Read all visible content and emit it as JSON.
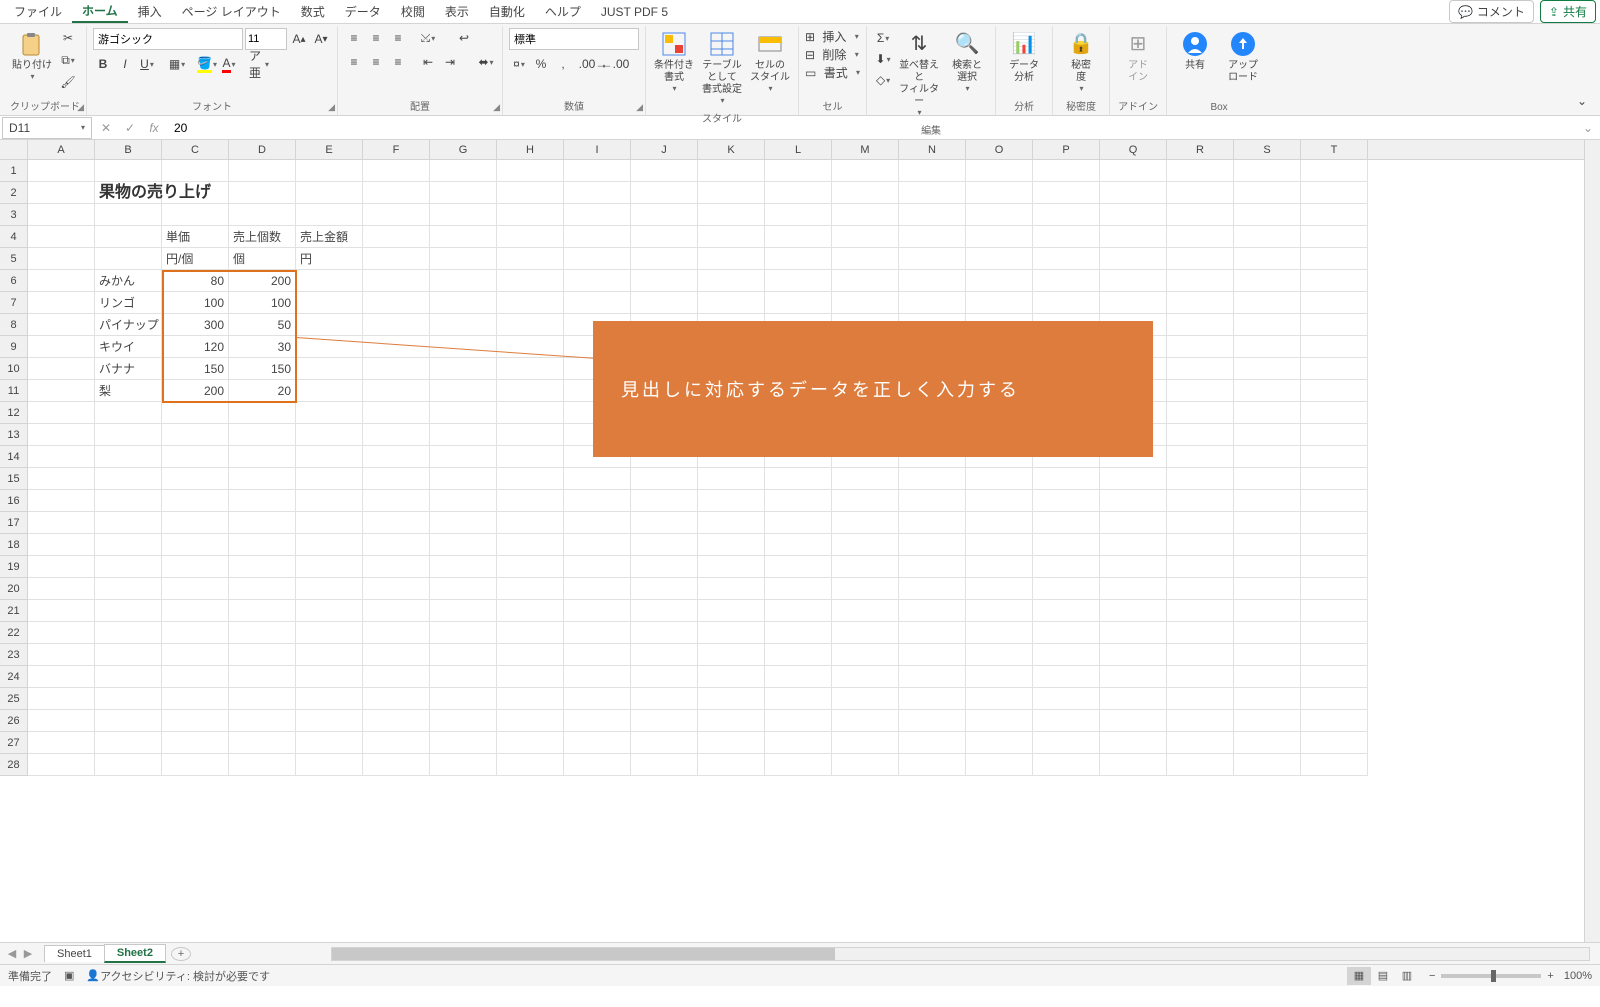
{
  "tabs": {
    "file": "ファイル",
    "home": "ホーム",
    "insert": "挿入",
    "page_layout": "ページ レイアウト",
    "formulas": "数式",
    "data": "データ",
    "review": "校閲",
    "view": "表示",
    "automate": "自動化",
    "help": "ヘルプ",
    "just_pdf": "JUST PDF 5"
  },
  "header_buttons": {
    "comment": "コメント",
    "share": "共有"
  },
  "ribbon": {
    "clipboard": {
      "paste": "貼り付け",
      "label": "クリップボード"
    },
    "font": {
      "name": "游ゴシック",
      "size": "11",
      "label": "フォント"
    },
    "alignment": {
      "label": "配置"
    },
    "number": {
      "format": "標準",
      "label": "数値"
    },
    "styles": {
      "cond": "条件付き\n書式",
      "table": "テーブルとして\n書式設定",
      "cell": "セルの\nスタイル",
      "label": "スタイル"
    },
    "cells": {
      "insert": "挿入",
      "delete": "削除",
      "format": "書式",
      "label": "セル"
    },
    "editing": {
      "sort": "並べ替えと\nフィルター",
      "find": "検索と\n選択",
      "label": "編集"
    },
    "analysis": {
      "data": "データ\n分析",
      "label": "分析"
    },
    "sensitivity": {
      "btn": "秘密\n度",
      "label": "秘密度"
    },
    "addins": {
      "btn": "アド\nイン",
      "label": "アドイン"
    },
    "box": {
      "share": "共有",
      "upload": "アップ\nロード",
      "label": "Box"
    }
  },
  "namebox": "D11",
  "formula_value": "20",
  "columns": [
    "A",
    "B",
    "C",
    "D",
    "E",
    "F",
    "G",
    "H",
    "I",
    "J",
    "K",
    "L",
    "M",
    "N",
    "O",
    "P",
    "Q",
    "R",
    "S",
    "T"
  ],
  "rows": [
    "1",
    "2",
    "3",
    "4",
    "5",
    "6",
    "7",
    "8",
    "9",
    "10",
    "11",
    "12",
    "13",
    "14",
    "15",
    "16",
    "17",
    "18",
    "19",
    "20",
    "21",
    "22",
    "23",
    "24",
    "25",
    "26",
    "27",
    "28"
  ],
  "sheet": {
    "title": "果物の売り上げ",
    "h_price": "単価",
    "h_qty": "売上個数",
    "h_amt": "売上金額",
    "u_price": "円/個",
    "u_qty": "個",
    "u_amt": "円",
    "rows": [
      {
        "name": "みかん",
        "price": "80",
        "qty": "200"
      },
      {
        "name": "リンゴ",
        "price": "100",
        "qty": "100"
      },
      {
        "name": "パイナップ",
        "price": "300",
        "qty": "50"
      },
      {
        "name": "キウイ",
        "price": "120",
        "qty": "30"
      },
      {
        "name": "バナナ",
        "price": "150",
        "qty": "150"
      },
      {
        "name": "梨",
        "price": "200",
        "qty": "20"
      }
    ]
  },
  "callout_text": "見出しに対応するデータを正しく入力する",
  "sheet_tabs": {
    "s1": "Sheet1",
    "s2": "Sheet2"
  },
  "status": {
    "ready": "準備完了",
    "accessibility": "アクセシビリティ: 検討が必要です",
    "zoom": "100%"
  }
}
